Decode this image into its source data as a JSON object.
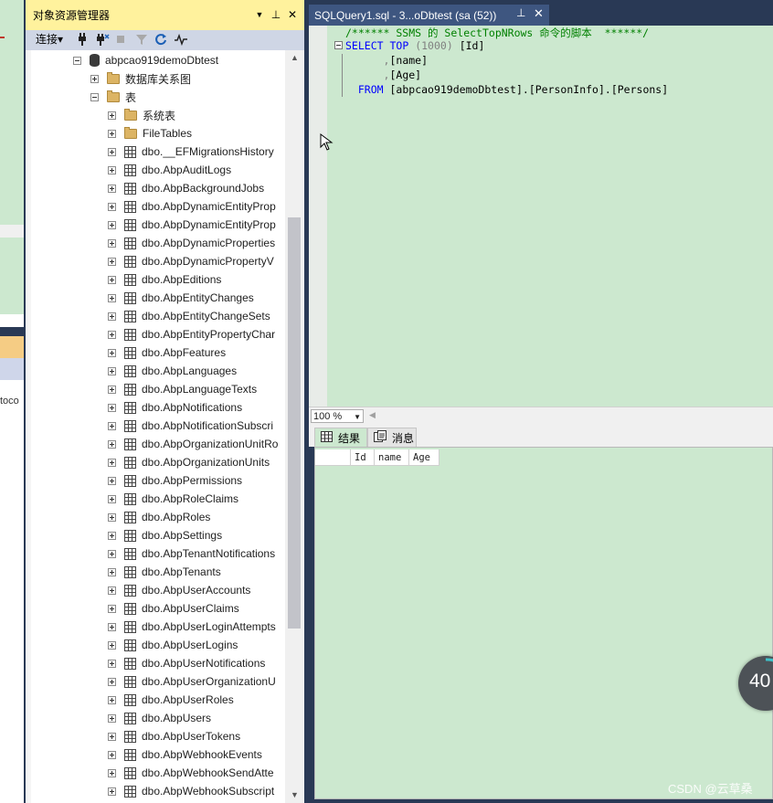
{
  "left_window": {
    "partial_text": "toco"
  },
  "object_explorer": {
    "title": "对象资源管理器",
    "title_controls": {
      "dropdown": "▼",
      "pin": "⊥",
      "close": "✕"
    },
    "toolbar": {
      "connect_label": "连接",
      "connect_arrow": "▾"
    },
    "tree": {
      "database": "abpcao919demoDbtest",
      "diagrams_folder": "数据库关系图",
      "tables_folder": "表",
      "system_tables_folder": "系统表",
      "file_tables_folder": "FileTables",
      "tables": [
        "dbo.__EFMigrationsHistory",
        "dbo.AbpAuditLogs",
        "dbo.AbpBackgroundJobs",
        "dbo.AbpDynamicEntityProp",
        "dbo.AbpDynamicEntityProp",
        "dbo.AbpDynamicProperties",
        "dbo.AbpDynamicPropertyV",
        "dbo.AbpEditions",
        "dbo.AbpEntityChanges",
        "dbo.AbpEntityChangeSets",
        "dbo.AbpEntityPropertyChar",
        "dbo.AbpFeatures",
        "dbo.AbpLanguages",
        "dbo.AbpLanguageTexts",
        "dbo.AbpNotifications",
        "dbo.AbpNotificationSubscri",
        "dbo.AbpOrganizationUnitRo",
        "dbo.AbpOrganizationUnits",
        "dbo.AbpPermissions",
        "dbo.AbpRoleClaims",
        "dbo.AbpRoles",
        "dbo.AbpSettings",
        "dbo.AbpTenantNotifications",
        "dbo.AbpTenants",
        "dbo.AbpUserAccounts",
        "dbo.AbpUserClaims",
        "dbo.AbpUserLoginAttempts",
        "dbo.AbpUserLogins",
        "dbo.AbpUserNotifications",
        "dbo.AbpUserOrganizationU",
        "dbo.AbpUserRoles",
        "dbo.AbpUsers",
        "dbo.AbpUserTokens",
        "dbo.AbpWebhookEvents",
        "dbo.AbpWebhookSendAtte",
        "dbo.AbpWebhookSubscript"
      ]
    }
  },
  "editor": {
    "tab_title": "SQLQuery1.sql - 3...oDbtest (sa (52))",
    "tab_pin": "⊥",
    "tab_close": "✕",
    "code": {
      "comment": "/****** SSMS 的 SelectTopNRows 命令的脚本  ******/",
      "select_kw": "SELECT",
      "top_kw": "TOP",
      "top_arg": "(1000)",
      "col1": "[Id]",
      "comma": ",",
      "col2": "[name]",
      "col3": "[Age]",
      "from_kw": "FROM",
      "table_ref": "[abpcao919demoDbtest].[PersonInfo].[Persons]"
    },
    "zoom": "100 %"
  },
  "results": {
    "tab_results": "结果",
    "tab_messages": "消息",
    "columns": [
      "Id",
      "name",
      "Age"
    ]
  },
  "progress_badge": {
    "value": "40"
  },
  "watermark": "CSDN @云草桑"
}
